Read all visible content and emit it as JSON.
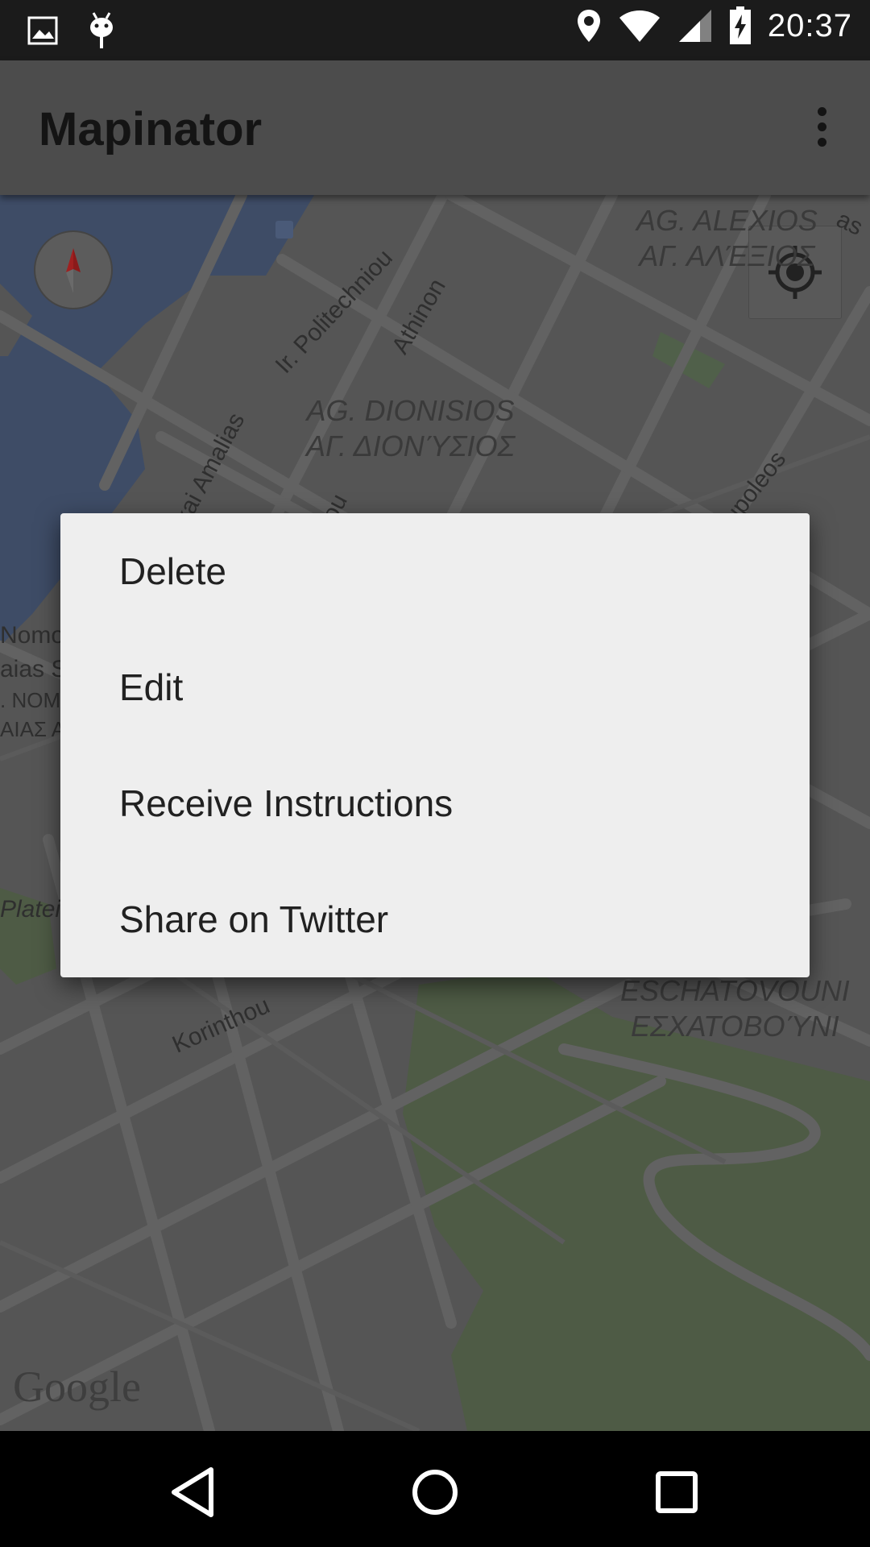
{
  "status_bar": {
    "time": "20:37",
    "left_icons": [
      "image-icon",
      "android-debug-icon"
    ],
    "right_icons": [
      "location-icon",
      "wifi-icon",
      "signal-icon",
      "battery-charging-icon"
    ]
  },
  "app_bar": {
    "title": "Mapinator",
    "overflow_icon": "more-vert-icon"
  },
  "map": {
    "area_labels": [
      {
        "latin": "AG. ALEXIOS",
        "greek": "ΑΓ. ΑΛΈΞΙΟΣ"
      },
      {
        "latin": "AG. DIONISIOS",
        "greek": "ΑΓ. ΔΙΟΝΎΣΙΟΣ"
      },
      {
        "latin": "ESCHATOVOUNI",
        "greek": "ΕΣΧΑΤΟΒΟΎΝΙ"
      }
    ],
    "street_labels": [
      "Ir. Politechniou",
      "Athinon",
      "kai Amalias",
      "iou",
      "upoleos",
      "Korinthou",
      "Plateia",
      "Nomo",
      "aias S",
      ". ΝΟΜ",
      "ΑΙΑΣ Α",
      "as"
    ],
    "attribution": "Google",
    "compass_icon": "compass-icon",
    "locate_icon": "my-location-icon"
  },
  "context_menu": {
    "items": [
      {
        "label": "Delete"
      },
      {
        "label": "Edit"
      },
      {
        "label": "Receive Instructions"
      },
      {
        "label": "Share on Twitter"
      }
    ]
  },
  "nav_bar": {
    "back": "back-icon",
    "home": "home-icon",
    "recents": "recents-icon"
  },
  "colors": {
    "dialog_bg": "#eeeeee",
    "appbar_bg": "#4c4c4c",
    "statusbar_bg": "#1b1b1b",
    "water": "#3e4c66",
    "park": "#4e5b45"
  }
}
